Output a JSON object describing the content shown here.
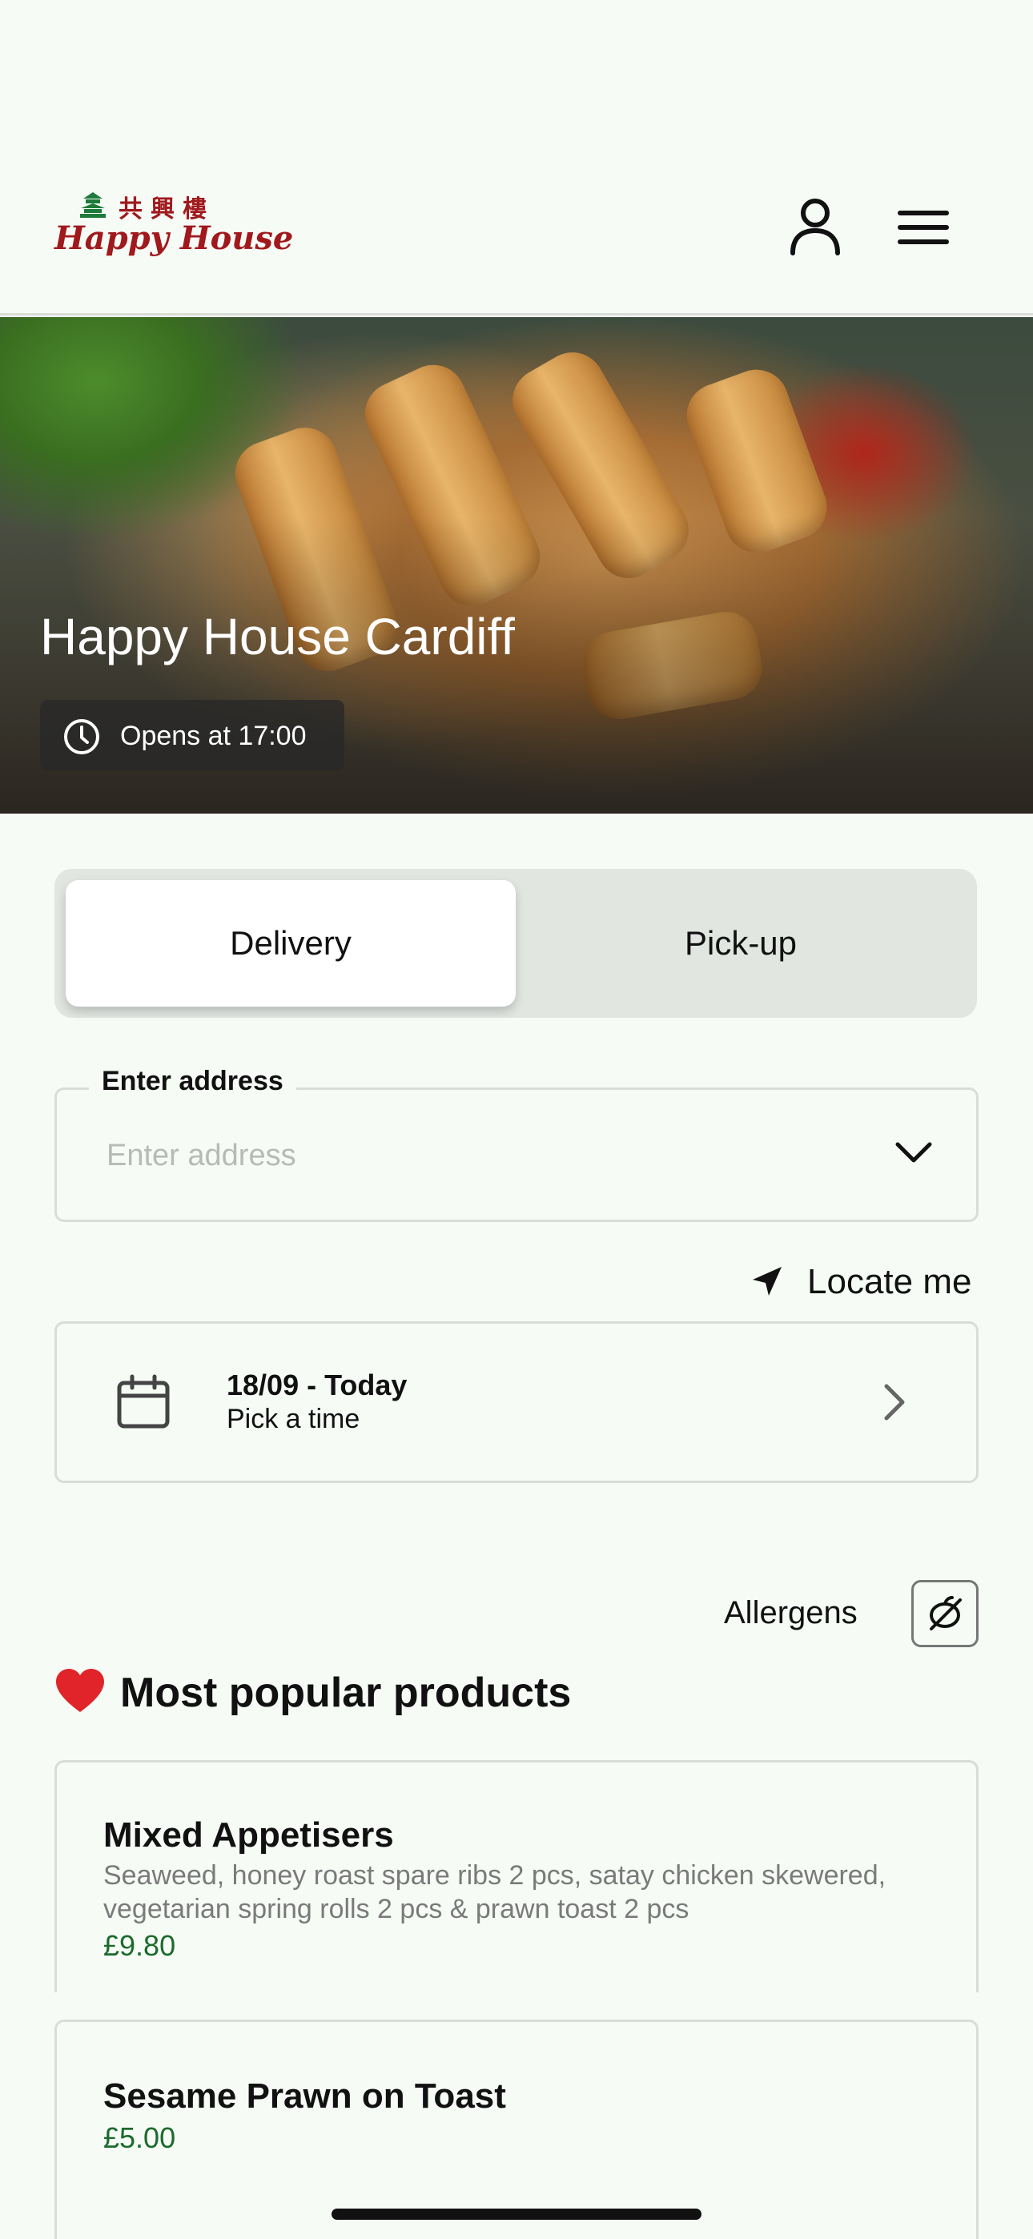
{
  "header": {
    "logo_chinese": "共興樓",
    "logo_script": "Happy House",
    "account_icon": "user-icon",
    "menu_icon": "hamburger-menu-icon"
  },
  "hero": {
    "title": "Happy House Cardiff",
    "status": "Opens at 17:00",
    "status_icon": "clock-icon"
  },
  "order_mode": {
    "options": [
      "Delivery",
      "Pick-up"
    ],
    "selected": "Delivery"
  },
  "address": {
    "label": "Enter address",
    "placeholder": "Enter address",
    "value": ""
  },
  "locate": {
    "label": "Locate me",
    "icon": "location-arrow-icon"
  },
  "schedule": {
    "date": "18/09 - Today",
    "subtitle": "Pick a time",
    "icon": "calendar-icon"
  },
  "allergens": {
    "label": "Allergens",
    "icon": "allergen-filter-icon"
  },
  "popular": {
    "title": "Most popular products",
    "icon": "heart-icon",
    "products": [
      {
        "name": "Mixed Appetisers",
        "description": "Seaweed, honey roast spare ribs 2 pcs, satay chicken skewered, vegetarian spring rolls 2 pcs & prawn toast 2 pcs",
        "price": "£9.80"
      },
      {
        "name": "Sesame Prawn on Toast",
        "price": "£5.00"
      }
    ]
  },
  "colors": {
    "background": "#f6fbf6",
    "brand_red": "#a0191c",
    "price_green": "#1b6b2c"
  }
}
